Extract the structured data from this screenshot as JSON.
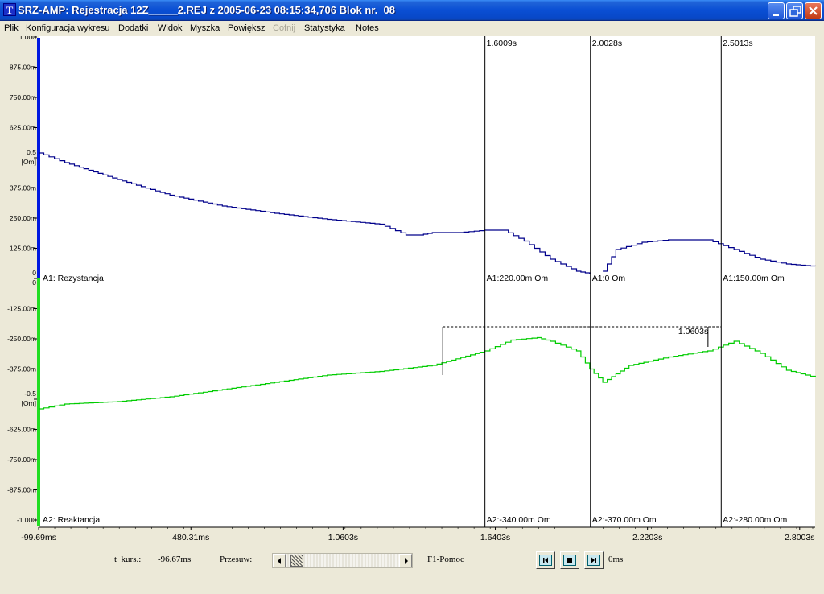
{
  "window": {
    "title": "SRZ-AMP: Rejestracja 12Z_____2.REJ z 2005-06-23 08:15:34,706 Blok nr.  08",
    "icon_letter": "T",
    "title_bar_color": "#0A4FD4"
  },
  "menu": {
    "items": [
      {
        "label": "Plik",
        "enabled": true
      },
      {
        "label": "Konfiguracja wykresu",
        "enabled": true
      },
      {
        "label": "Dodatki",
        "enabled": true
      },
      {
        "label": "Widok",
        "enabled": true
      },
      {
        "label": "Myszka",
        "enabled": true
      },
      {
        "label": "Powiększ",
        "enabled": true
      },
      {
        "label": "Cofnij",
        "enabled": false
      },
      {
        "label": "Statystyka",
        "enabled": true
      },
      {
        "label": "Notes",
        "enabled": true
      }
    ]
  },
  "chart_data": {
    "type": "line",
    "colors": {
      "A1": "#00008B",
      "A2": "#00CC00",
      "axis_A1": "#0018E0",
      "axis_A2": "#22DD22",
      "background": "#FFFFFF"
    },
    "x_range_s": [
      -0.1,
      2.85
    ],
    "x_ticks": [
      {
        "value": -0.09969,
        "label": "-99.69ms"
      },
      {
        "value": 0.48031,
        "label": "480.31ms"
      },
      {
        "value": 1.0603,
        "label": "1.0603s"
      },
      {
        "value": 1.6403,
        "label": "1.6403s"
      },
      {
        "value": 2.2203,
        "label": "2.2203s"
      },
      {
        "value": 2.8003,
        "label": "2.8003s"
      }
    ],
    "y_ticks": [
      {
        "value": 1.0,
        "label": "1.000"
      },
      {
        "value": 0.875,
        "label": "875.00m"
      },
      {
        "value": 0.75,
        "label": "750.00m"
      },
      {
        "value": 0.625,
        "label": "625.00m"
      },
      {
        "value": 0.5,
        "label": "0.5",
        "sublabel": "[Om]"
      },
      {
        "value": 0.375,
        "label": "375.00m"
      },
      {
        "value": 0.25,
        "label": "250.00m"
      },
      {
        "value": 0.125,
        "label": "125.00m"
      },
      {
        "value": 0.0,
        "label": "0",
        "sublabel": "0"
      },
      {
        "value": -0.125,
        "label": "-125.00m"
      },
      {
        "value": -0.25,
        "label": "-250.00m"
      },
      {
        "value": -0.375,
        "label": "-375.00m"
      },
      {
        "value": -0.5,
        "label": "-0.5",
        "sublabel": "[Om]"
      },
      {
        "value": -0.625,
        "label": "-625.00m"
      },
      {
        "value": -0.75,
        "label": "-750.00m"
      },
      {
        "value": -0.875,
        "label": "-875.00m"
      },
      {
        "value": -1.0,
        "label": "-1.000"
      }
    ],
    "series": [
      {
        "name": "A1: Rezystancja",
        "x": [
          -0.1,
          0.0,
          0.2,
          0.4,
          0.6,
          0.8,
          1.0,
          1.2,
          1.3,
          1.35,
          1.4,
          1.5,
          1.6,
          1.67,
          1.75,
          1.85,
          1.95,
          2.0,
          2.02,
          2.05,
          2.1,
          2.2,
          2.3,
          2.45,
          2.55,
          2.65,
          2.75,
          2.86
        ],
        "y": [
          0.52,
          0.48,
          0.41,
          0.345,
          0.3,
          0.27,
          0.245,
          0.225,
          0.18,
          0.18,
          0.19,
          0.19,
          0.2,
          0.2,
          0.155,
          0.08,
          0.03,
          0.02,
          null,
          0.03,
          0.12,
          0.15,
          0.16,
          0.16,
          0.12,
          0.08,
          0.06,
          0.05
        ]
      },
      {
        "name": "A2: Reaktancja",
        "x": [
          -0.1,
          0.0,
          0.2,
          0.4,
          0.6,
          0.8,
          1.0,
          1.2,
          1.4,
          1.6,
          1.7,
          1.8,
          1.85,
          1.95,
          2.0,
          2.05,
          2.1,
          2.15,
          2.3,
          2.45,
          2.55,
          2.65,
          2.75,
          2.86
        ],
        "y": [
          -0.54,
          -0.52,
          -0.51,
          -0.49,
          -0.46,
          -0.43,
          -0.4,
          -0.385,
          -0.36,
          -0.3,
          -0.255,
          -0.245,
          -0.26,
          -0.3,
          -0.375,
          -0.43,
          -0.395,
          -0.36,
          -0.325,
          -0.3,
          -0.26,
          -0.31,
          -0.38,
          -0.41
        ]
      }
    ],
    "cursors": [
      {
        "x": 1.6009,
        "label": "1.6009s",
        "a1_label": "A1:220.00m Om",
        "a2_label": "A2:-340.00m Om"
      },
      {
        "x": 2.0028,
        "label": "2.0028s",
        "a1_label": "A1:0 Om",
        "a2_label": "A2:-370.00m Om"
      },
      {
        "x": 2.5013,
        "label": "2.5013s",
        "a1_label": "A1:150.00m Om",
        "a2_label": "A2:-280.00m Om"
      }
    ],
    "measurement": {
      "x_start": 1.44,
      "x_end": 2.5,
      "label": "1.0603s"
    }
  },
  "footer": {
    "t_kurs_label": "t_kurs.:",
    "t_kurs_value": "-96.67ms",
    "przesuw_label": "Przesuw:",
    "scroll_position": 0.05,
    "help": "F1-Pomoc",
    "buttons": [
      "step-back-icon",
      "stop-icon",
      "step-forward-icon"
    ],
    "offset_value": "0ms"
  }
}
